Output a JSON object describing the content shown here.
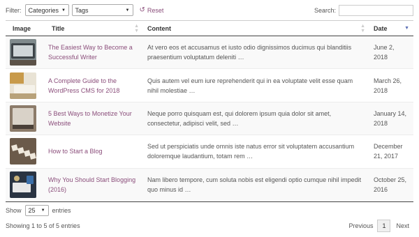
{
  "filter": {
    "label": "Filter:",
    "category_value": "Categories",
    "tags_value": "Tags",
    "reset_label": "Reset",
    "search_label": "Search:",
    "search_value": ""
  },
  "table": {
    "headers": [
      "Image",
      "Title",
      "Content",
      "Date"
    ],
    "rows": [
      {
        "title": "The Easiest Way to Become a Successful Writer",
        "content": "At vero eos et accusamus et iusto odio dignissimos ducimus qui blanditiis praesentium voluptatum deleniti …",
        "date": "June 2, 2018"
      },
      {
        "title": "A Complete Guide to the WordPress CMS for 2018",
        "content": "Quis autem vel eum iure reprehenderit qui in ea voluptate velit esse quam nihil molestiae …",
        "date": "March 26, 2018"
      },
      {
        "title": "5 Best Ways to Monetize Your Website",
        "content": "Neque porro quisquam est, qui dolorem ipsum quia dolor sit amet, consectetur, adipisci velit, sed …",
        "date": "January 14, 2018"
      },
      {
        "title": "How to Start a Blog",
        "content": "Sed ut perspiciatis unde omnis iste natus error sit voluptatem accusantium doloremque laudantium, totam rem …",
        "date": "December 21, 2017"
      },
      {
        "title": "Why You Should Start Blogging (2016)",
        "content": "Nam libero tempore, cum soluta nobis est eligendi optio cumque nihil impedit quo minus id …",
        "date": "October 25, 2016"
      }
    ]
  },
  "length": {
    "show_label": "Show",
    "value": "25",
    "entries_label": "entries"
  },
  "info": "Showing 1 to 5 of 5 entries",
  "pagination": {
    "previous": "Previous",
    "page": "1",
    "next": "Next"
  },
  "colors": {
    "link": "#8a4d7a",
    "sort_active": "#5b6fb5"
  }
}
